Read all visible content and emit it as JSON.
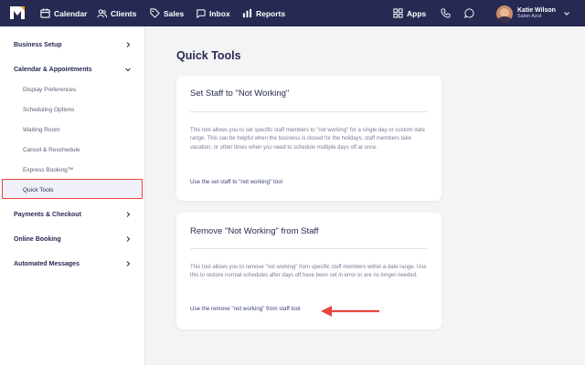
{
  "nav": {
    "items": [
      {
        "label": "Calendar",
        "icon": "calendar-icon"
      },
      {
        "label": "Clients",
        "icon": "clients-icon"
      },
      {
        "label": "Sales",
        "icon": "tag-icon"
      },
      {
        "label": "Inbox",
        "icon": "inbox-icon"
      },
      {
        "label": "Reports",
        "icon": "bar-chart-icon"
      },
      {
        "label": "Apps",
        "icon": "grid-icon"
      }
    ],
    "user": {
      "name": "Katie Wilson",
      "salon": "Salon Azul"
    }
  },
  "sidebar": {
    "items": [
      {
        "label": "Business Setup"
      },
      {
        "label": "Calendar & Appointments"
      },
      {
        "label": "Display Preferences"
      },
      {
        "label": "Scheduling Options"
      },
      {
        "label": "Waiting Room"
      },
      {
        "label": "Cancel & Reschedule"
      },
      {
        "label": "Express Booking™"
      },
      {
        "label": "Quick Tools"
      },
      {
        "label": "Payments & Checkout"
      },
      {
        "label": "Online Booking"
      },
      {
        "label": "Automated Messages"
      }
    ]
  },
  "main": {
    "title": "Quick Tools",
    "cards": [
      {
        "title": "Set Staff to \"Not Working\"",
        "desc": "This tool allows you to set specific staff members to \"not working\" for a single day or custom date range. This can be helpful when the business is closed for the holidays, staff members take vacation, or other times when you need to schedule multiple days off at once.",
        "link": "Use the set staff to \"not working\" tool"
      },
      {
        "title": "Remove \"Not Working\" from Staff",
        "desc": "This tool allows you to remove \"not working\" from specific staff members within a date range. Use this to restore normal schedules after days off have been set in error or are no longer needed.",
        "link": "Use the remove \"not working\" from staff tool"
      }
    ]
  },
  "colors": {
    "nav_bg": "#262a52",
    "highlight": "#e8453c",
    "link": "#3c4280"
  }
}
